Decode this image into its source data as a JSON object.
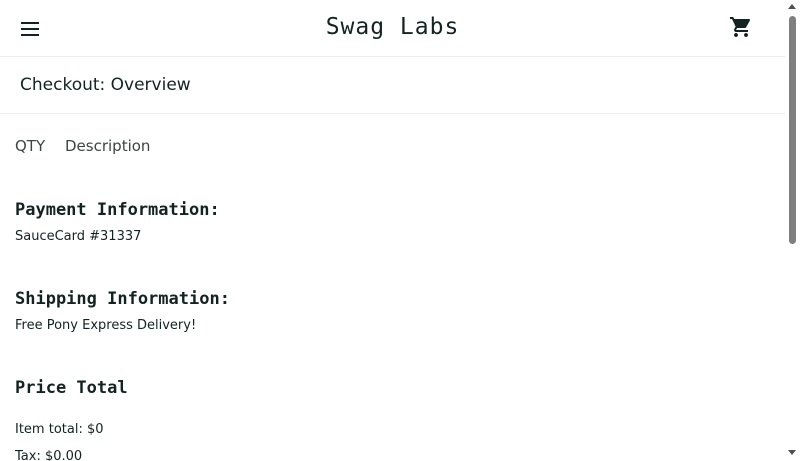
{
  "app": {
    "title": "Swag Labs"
  },
  "header": {
    "menu_icon": "hamburger-menu-icon",
    "cart_icon": "shopping-cart-icon"
  },
  "page": {
    "title": "Checkout: Overview"
  },
  "cart_list": {
    "qty_header": "QTY",
    "description_header": "Description"
  },
  "summary": {
    "payment_label": "Payment Information:",
    "payment_value": "SauceCard #31337",
    "shipping_label": "Shipping Information:",
    "shipping_value": "Free Pony Express Delivery!",
    "price_total_label": "Price Total",
    "item_total": "Item total: $0",
    "tax": "Tax: $0.00"
  },
  "colors": {
    "text": "#132322",
    "divider": "#ededed",
    "scroll_thumb": "#7f7f7f"
  }
}
